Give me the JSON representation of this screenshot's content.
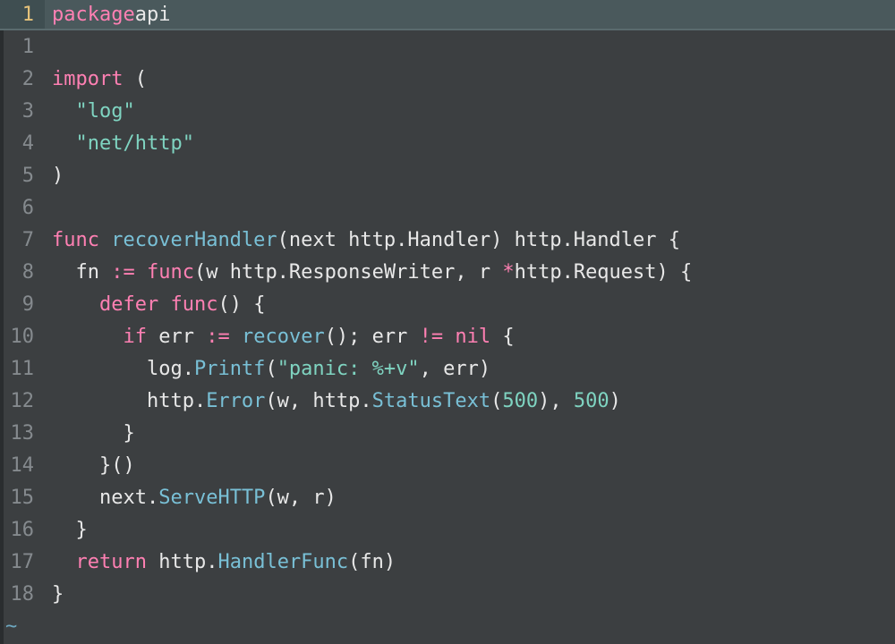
{
  "title": {
    "number": "1",
    "tokens": [
      {
        "t": "package",
        "c": "kw"
      },
      {
        "t": " ",
        "c": "punct"
      },
      {
        "t": "api",
        "c": "ident"
      }
    ]
  },
  "lines": [
    {
      "num": "1",
      "tokens": []
    },
    {
      "num": "2",
      "tokens": [
        {
          "t": "import",
          "c": "kw"
        },
        {
          "t": " (",
          "c": "punct"
        }
      ]
    },
    {
      "num": "3",
      "tokens": [
        {
          "t": "  ",
          "c": "punct"
        },
        {
          "t": "\"log\"",
          "c": "str"
        }
      ]
    },
    {
      "num": "4",
      "tokens": [
        {
          "t": "  ",
          "c": "punct"
        },
        {
          "t": "\"net/http\"",
          "c": "str"
        }
      ]
    },
    {
      "num": "5",
      "tokens": [
        {
          "t": ")",
          "c": "punct"
        }
      ]
    },
    {
      "num": "6",
      "tokens": []
    },
    {
      "num": "7",
      "tokens": [
        {
          "t": "func",
          "c": "kw"
        },
        {
          "t": " ",
          "c": "punct"
        },
        {
          "t": "recoverHandler",
          "c": "fn"
        },
        {
          "t": "(next http.Handler) http.Handler {",
          "c": "punct"
        }
      ]
    },
    {
      "num": "8",
      "tokens": [
        {
          "t": "  fn ",
          "c": "punct"
        },
        {
          "t": ":=",
          "c": "op"
        },
        {
          "t": " ",
          "c": "punct"
        },
        {
          "t": "func",
          "c": "kw"
        },
        {
          "t": "(w http.ResponseWriter, r ",
          "c": "punct"
        },
        {
          "t": "*",
          "c": "op"
        },
        {
          "t": "http.Request) {",
          "c": "punct"
        }
      ]
    },
    {
      "num": "9",
      "tokens": [
        {
          "t": "    ",
          "c": "punct"
        },
        {
          "t": "defer",
          "c": "kw"
        },
        {
          "t": " ",
          "c": "punct"
        },
        {
          "t": "func",
          "c": "kw"
        },
        {
          "t": "() {",
          "c": "punct"
        }
      ]
    },
    {
      "num": "10",
      "tokens": [
        {
          "t": "      ",
          "c": "punct"
        },
        {
          "t": "if",
          "c": "kw"
        },
        {
          "t": " err ",
          "c": "punct"
        },
        {
          "t": ":=",
          "c": "op"
        },
        {
          "t": " ",
          "c": "punct"
        },
        {
          "t": "recover",
          "c": "fn"
        },
        {
          "t": "(); err ",
          "c": "punct"
        },
        {
          "t": "!=",
          "c": "op"
        },
        {
          "t": " ",
          "c": "punct"
        },
        {
          "t": "nil",
          "c": "kw"
        },
        {
          "t": " {",
          "c": "punct"
        }
      ]
    },
    {
      "num": "11",
      "tokens": [
        {
          "t": "        log.",
          "c": "punct"
        },
        {
          "t": "Printf",
          "c": "fn"
        },
        {
          "t": "(",
          "c": "punct"
        },
        {
          "t": "\"panic: %+v\"",
          "c": "str"
        },
        {
          "t": ", err)",
          "c": "punct"
        }
      ]
    },
    {
      "num": "12",
      "tokens": [
        {
          "t": "        http.",
          "c": "punct"
        },
        {
          "t": "Error",
          "c": "fn"
        },
        {
          "t": "(w, http.",
          "c": "punct"
        },
        {
          "t": "StatusText",
          "c": "fn"
        },
        {
          "t": "(",
          "c": "punct"
        },
        {
          "t": "500",
          "c": "num"
        },
        {
          "t": "), ",
          "c": "punct"
        },
        {
          "t": "500",
          "c": "num"
        },
        {
          "t": ")",
          "c": "punct"
        }
      ]
    },
    {
      "num": "13",
      "tokens": [
        {
          "t": "      }",
          "c": "punct"
        }
      ]
    },
    {
      "num": "14",
      "tokens": [
        {
          "t": "    }()",
          "c": "punct"
        }
      ]
    },
    {
      "num": "15",
      "tokens": [
        {
          "t": "    next.",
          "c": "punct"
        },
        {
          "t": "ServeHTTP",
          "c": "fn"
        },
        {
          "t": "(w, r)",
          "c": "punct"
        }
      ]
    },
    {
      "num": "16",
      "tokens": [
        {
          "t": "  }",
          "c": "punct"
        }
      ]
    },
    {
      "num": "17",
      "tokens": [
        {
          "t": "  ",
          "c": "punct"
        },
        {
          "t": "return",
          "c": "kw"
        },
        {
          "t": " http.",
          "c": "punct"
        },
        {
          "t": "HandlerFunc",
          "c": "fn"
        },
        {
          "t": "(fn)",
          "c": "punct"
        }
      ]
    },
    {
      "num": "18",
      "tokens": [
        {
          "t": "}",
          "c": "punct"
        }
      ]
    }
  ],
  "tilde": "~"
}
